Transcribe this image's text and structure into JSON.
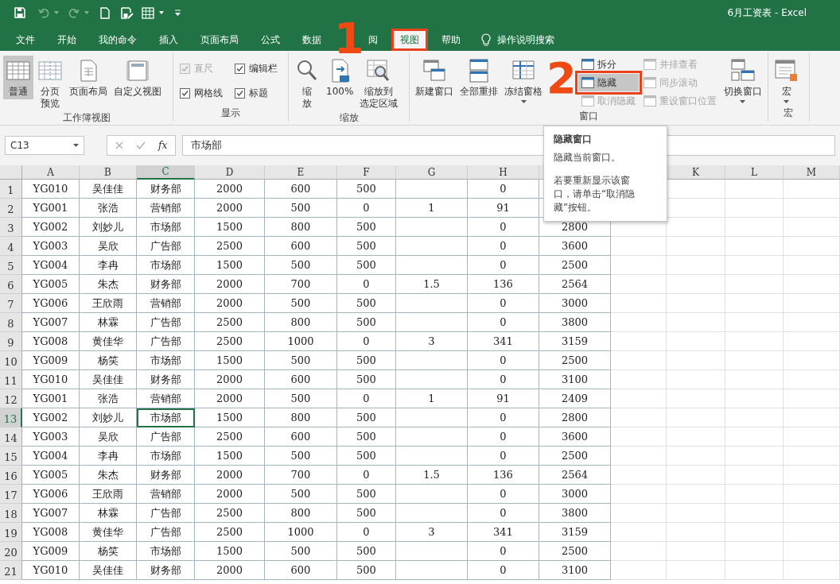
{
  "window": {
    "title": "6月工资表  -  Excel"
  },
  "tabs": [
    {
      "label": "文件",
      "selected": false,
      "highlighted": false
    },
    {
      "label": "开始",
      "selected": false,
      "highlighted": false
    },
    {
      "label": "我的命令",
      "selected": false,
      "highlighted": false
    },
    {
      "label": "插入",
      "selected": false,
      "highlighted": false
    },
    {
      "label": "页面布局",
      "selected": false,
      "highlighted": false
    },
    {
      "label": "公式",
      "selected": false,
      "highlighted": false
    },
    {
      "label": "数据",
      "selected": false,
      "highlighted": false
    },
    {
      "label": "阅",
      "selected": false,
      "highlighted": false
    },
    {
      "label": "视图",
      "selected": true,
      "highlighted": true
    },
    {
      "label": "帮助",
      "selected": false,
      "highlighted": false
    }
  ],
  "tell_me": "操作说明搜索",
  "ribbon": {
    "groups": [
      {
        "label": "工作簿视图",
        "items": [
          {
            "kind": "large",
            "lines": [
              "普通"
            ],
            "selected": true
          },
          {
            "kind": "large",
            "lines": [
              "分页",
              "预览"
            ],
            "selected": false
          },
          {
            "kind": "large",
            "lines": [
              "页面布局"
            ],
            "selected": false
          },
          {
            "kind": "large",
            "lines": [
              "自定义视图"
            ],
            "selected": false
          }
        ]
      },
      {
        "label": "显示",
        "items": [
          {
            "kind": "check",
            "label": "直尺",
            "checked": true,
            "disabled": true
          },
          {
            "kind": "check",
            "label": "编辑栏",
            "checked": true,
            "disabled": false
          },
          {
            "kind": "check",
            "label": "网格线",
            "checked": true,
            "disabled": false
          },
          {
            "kind": "check",
            "label": "标题",
            "checked": true,
            "disabled": false
          }
        ]
      },
      {
        "label": "缩放",
        "items": [
          {
            "kind": "large",
            "lines": [
              "缩",
              "放"
            ],
            "selected": false
          },
          {
            "kind": "large",
            "lines": [
              "100%"
            ],
            "selected": false
          },
          {
            "kind": "large",
            "lines": [
              "缩放到",
              "选定区域"
            ],
            "selected": false
          }
        ]
      },
      {
        "label": "窗口",
        "items": [
          {
            "kind": "large",
            "lines": [
              "新建窗口"
            ],
            "selected": false
          },
          {
            "kind": "large",
            "lines": [
              "全部重排"
            ],
            "selected": false
          },
          {
            "kind": "large",
            "lines": [
              "冻结窗格"
            ],
            "selected": false,
            "dropdown": true
          },
          {
            "kind": "small",
            "label": "拆分",
            "disabled": false,
            "highlighted": false
          },
          {
            "kind": "small",
            "label": "隐藏",
            "disabled": false,
            "highlighted": true
          },
          {
            "kind": "small",
            "label": "取消隐藏",
            "disabled": true,
            "highlighted": false
          },
          {
            "kind": "small",
            "label": "并排查看",
            "disabled": true,
            "highlighted": false
          },
          {
            "kind": "small",
            "label": "同步滚动",
            "disabled": true,
            "highlighted": false
          },
          {
            "kind": "small",
            "label": "重设窗口位置",
            "disabled": true,
            "highlighted": false
          },
          {
            "kind": "large",
            "lines": [
              "切换窗口"
            ],
            "selected": false,
            "dropdown": true
          }
        ]
      },
      {
        "label": "宏",
        "items": [
          {
            "kind": "large",
            "lines": [
              "宏"
            ],
            "selected": false,
            "dropdown": true
          }
        ]
      }
    ]
  },
  "annotations": [
    {
      "label": "1"
    },
    {
      "label": "2"
    }
  ],
  "tooltip": {
    "title": "隐藏窗口",
    "text": "隐藏当前窗口。",
    "note": "若要重新显示该窗口，请单击“取消隐藏”按钮。"
  },
  "formula_bar": {
    "name_box": "C13",
    "function_button": "fx",
    "value": "市场部"
  },
  "columns": [
    {
      "label": "A",
      "selected": false
    },
    {
      "label": "B",
      "selected": false
    },
    {
      "label": "C",
      "selected": true
    },
    {
      "label": "D",
      "selected": false
    },
    {
      "label": "E",
      "selected": false
    },
    {
      "label": "F",
      "selected": false
    },
    {
      "label": "G",
      "selected": false
    },
    {
      "label": "H",
      "selected": false
    },
    {},
    {},
    {
      "label": "K",
      "selected": false
    },
    {
      "label": "L",
      "selected": false
    },
    {
      "label": "M",
      "selected": false
    }
  ],
  "rows": [
    {
      "num": "1",
      "selected": false,
      "cells": [
        "YG010",
        "吴佳佳",
        "财务部",
        "2000",
        "600",
        "500",
        null,
        "0"
      ]
    },
    {
      "num": "2",
      "selected": false,
      "cells": [
        "YG001",
        "张浩",
        "营销部",
        "2000",
        "500",
        "0",
        "1",
        "91"
      ]
    },
    {
      "num": "3",
      "selected": false,
      "cells": [
        "YG002",
        "刘妙儿",
        "市场部",
        "1500",
        "800",
        "500",
        null,
        "0",
        "2800"
      ]
    },
    {
      "num": "4",
      "selected": false,
      "cells": [
        "YG003",
        "吴欣",
        "广告部",
        "2500",
        "600",
        "500",
        null,
        "0",
        "3600"
      ]
    },
    {
      "num": "5",
      "selected": false,
      "cells": [
        "YG004",
        "李冉",
        "市场部",
        "1500",
        "500",
        "500",
        null,
        "0",
        "2500"
      ]
    },
    {
      "num": "6",
      "selected": false,
      "cells": [
        "YG005",
        "朱杰",
        "财务部",
        "2000",
        "700",
        "0",
        "1.5",
        "136",
        "2564"
      ]
    },
    {
      "num": "7",
      "selected": false,
      "cells": [
        "YG006",
        "王欣雨",
        "营销部",
        "2000",
        "500",
        "500",
        null,
        "0",
        "3000"
      ]
    },
    {
      "num": "8",
      "selected": false,
      "cells": [
        "YG007",
        "林霖",
        "广告部",
        "2500",
        "800",
        "500",
        null,
        "0",
        "3800"
      ]
    },
    {
      "num": "9",
      "selected": false,
      "cells": [
        "YG008",
        "黄佳华",
        "广告部",
        "2500",
        "1000",
        "0",
        "3",
        "341",
        "3159"
      ]
    },
    {
      "num": "10",
      "selected": false,
      "cells": [
        "YG009",
        "杨笑",
        "市场部",
        "1500",
        "500",
        "500",
        null,
        "0",
        "2500"
      ]
    },
    {
      "num": "11",
      "selected": false,
      "cells": [
        "YG010",
        "吴佳佳",
        "财务部",
        "2000",
        "600",
        "500",
        null,
        "0",
        "3100"
      ]
    },
    {
      "num": "12",
      "selected": false,
      "cells": [
        "YG001",
        "张浩",
        "营销部",
        "2000",
        "500",
        "0",
        "1",
        "91",
        "2409"
      ]
    },
    {
      "num": "13",
      "selected": true,
      "cells": [
        "YG002",
        "刘妙儿",
        "市场部",
        "1500",
        "800",
        "500",
        null,
        "0",
        "2800"
      ]
    },
    {
      "num": "14",
      "selected": false,
      "cells": [
        "YG003",
        "吴欣",
        "广告部",
        "2500",
        "600",
        "500",
        null,
        "0",
        "3600"
      ]
    },
    {
      "num": "15",
      "selected": false,
      "cells": [
        "YG004",
        "李冉",
        "市场部",
        "1500",
        "500",
        "500",
        null,
        "0",
        "2500"
      ]
    },
    {
      "num": "16",
      "selected": false,
      "cells": [
        "YG005",
        "朱杰",
        "财务部",
        "2000",
        "700",
        "0",
        "1.5",
        "136",
        "2564"
      ]
    },
    {
      "num": "17",
      "selected": false,
      "cells": [
        "YG006",
        "王欣雨",
        "营销部",
        "2000",
        "500",
        "500",
        null,
        "0",
        "3000"
      ]
    },
    {
      "num": "18",
      "selected": false,
      "cells": [
        "YG007",
        "林霖",
        "广告部",
        "2500",
        "800",
        "500",
        null,
        "0",
        "3800"
      ]
    },
    {
      "num": "19",
      "selected": false,
      "cells": [
        "YG008",
        "黄佳华",
        "广告部",
        "2500",
        "1000",
        "0",
        "3",
        "341",
        "3159"
      ]
    },
    {
      "num": "20",
      "selected": false,
      "cells": [
        "YG009",
        "杨笑",
        "市场部",
        "1500",
        "500",
        "500",
        null,
        "0",
        "2500"
      ]
    },
    {
      "num": "21",
      "selected": false,
      "cells": [
        "YG010",
        "吴佳佳",
        "财务部",
        "2000",
        "600",
        "500",
        null,
        "0",
        "3100"
      ]
    }
  ]
}
